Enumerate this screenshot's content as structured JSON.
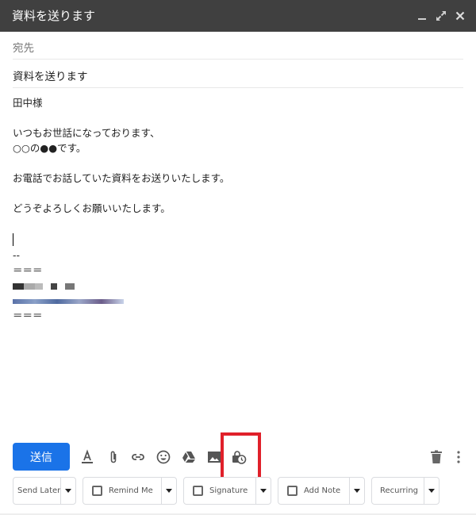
{
  "window": {
    "title": "資料を送ります",
    "controls": [
      "minimize",
      "expand",
      "close"
    ]
  },
  "compose": {
    "recipients_placeholder": "宛先",
    "subject": "資料を送ります",
    "body": {
      "greeting": "田中様",
      "line1": "いつもお世話になっております、",
      "line2": "○○の●●です。",
      "line3": "お電話でお話していた資料をお送りいたします。",
      "line4": "どうぞよろしくお願いいたします。",
      "signature_sep": "--",
      "sig_border_top": "＝＝＝",
      "sig_border_bottom": "＝＝＝"
    }
  },
  "toolbar": {
    "send_label": "送信",
    "icons": [
      "format-text",
      "attach",
      "link",
      "emoji",
      "drive",
      "photo",
      "confidential-mode",
      "delete",
      "more-options"
    ],
    "highlighted_icon": "confidential-mode",
    "highlight_color": "#e0202a",
    "accent": "#1a73e8"
  },
  "extensions": {
    "send_later": "Send Later",
    "remind_me": "Remind Me",
    "signature": "Signature",
    "add_note": "Add Note",
    "recurring": "Recurring"
  }
}
